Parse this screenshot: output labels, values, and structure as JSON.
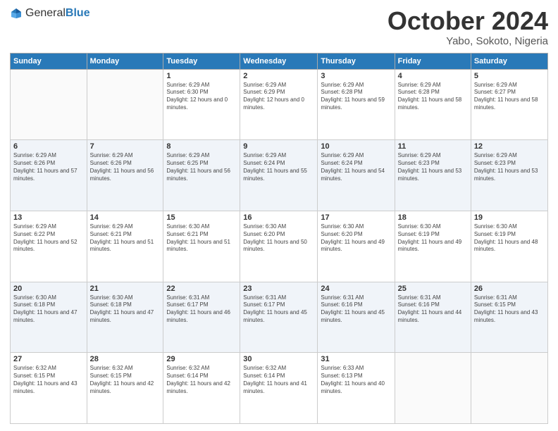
{
  "header": {
    "logo_general": "General",
    "logo_blue": "Blue",
    "month": "October 2024",
    "location": "Yabo, Sokoto, Nigeria"
  },
  "days_of_week": [
    "Sunday",
    "Monday",
    "Tuesday",
    "Wednesday",
    "Thursday",
    "Friday",
    "Saturday"
  ],
  "weeks": [
    [
      {
        "day": "",
        "empty": true
      },
      {
        "day": "",
        "empty": true
      },
      {
        "day": "1",
        "sunrise": "Sunrise: 6:29 AM",
        "sunset": "Sunset: 6:30 PM",
        "daylight": "Daylight: 12 hours and 0 minutes."
      },
      {
        "day": "2",
        "sunrise": "Sunrise: 6:29 AM",
        "sunset": "Sunset: 6:29 PM",
        "daylight": "Daylight: 12 hours and 0 minutes."
      },
      {
        "day": "3",
        "sunrise": "Sunrise: 6:29 AM",
        "sunset": "Sunset: 6:28 PM",
        "daylight": "Daylight: 11 hours and 59 minutes."
      },
      {
        "day": "4",
        "sunrise": "Sunrise: 6:29 AM",
        "sunset": "Sunset: 6:28 PM",
        "daylight": "Daylight: 11 hours and 58 minutes."
      },
      {
        "day": "5",
        "sunrise": "Sunrise: 6:29 AM",
        "sunset": "Sunset: 6:27 PM",
        "daylight": "Daylight: 11 hours and 58 minutes."
      }
    ],
    [
      {
        "day": "6",
        "sunrise": "Sunrise: 6:29 AM",
        "sunset": "Sunset: 6:26 PM",
        "daylight": "Daylight: 11 hours and 57 minutes."
      },
      {
        "day": "7",
        "sunrise": "Sunrise: 6:29 AM",
        "sunset": "Sunset: 6:26 PM",
        "daylight": "Daylight: 11 hours and 56 minutes."
      },
      {
        "day": "8",
        "sunrise": "Sunrise: 6:29 AM",
        "sunset": "Sunset: 6:25 PM",
        "daylight": "Daylight: 11 hours and 56 minutes."
      },
      {
        "day": "9",
        "sunrise": "Sunrise: 6:29 AM",
        "sunset": "Sunset: 6:24 PM",
        "daylight": "Daylight: 11 hours and 55 minutes."
      },
      {
        "day": "10",
        "sunrise": "Sunrise: 6:29 AM",
        "sunset": "Sunset: 6:24 PM",
        "daylight": "Daylight: 11 hours and 54 minutes."
      },
      {
        "day": "11",
        "sunrise": "Sunrise: 6:29 AM",
        "sunset": "Sunset: 6:23 PM",
        "daylight": "Daylight: 11 hours and 53 minutes."
      },
      {
        "day": "12",
        "sunrise": "Sunrise: 6:29 AM",
        "sunset": "Sunset: 6:23 PM",
        "daylight": "Daylight: 11 hours and 53 minutes."
      }
    ],
    [
      {
        "day": "13",
        "sunrise": "Sunrise: 6:29 AM",
        "sunset": "Sunset: 6:22 PM",
        "daylight": "Daylight: 11 hours and 52 minutes."
      },
      {
        "day": "14",
        "sunrise": "Sunrise: 6:29 AM",
        "sunset": "Sunset: 6:21 PM",
        "daylight": "Daylight: 11 hours and 51 minutes."
      },
      {
        "day": "15",
        "sunrise": "Sunrise: 6:30 AM",
        "sunset": "Sunset: 6:21 PM",
        "daylight": "Daylight: 11 hours and 51 minutes."
      },
      {
        "day": "16",
        "sunrise": "Sunrise: 6:30 AM",
        "sunset": "Sunset: 6:20 PM",
        "daylight": "Daylight: 11 hours and 50 minutes."
      },
      {
        "day": "17",
        "sunrise": "Sunrise: 6:30 AM",
        "sunset": "Sunset: 6:20 PM",
        "daylight": "Daylight: 11 hours and 49 minutes."
      },
      {
        "day": "18",
        "sunrise": "Sunrise: 6:30 AM",
        "sunset": "Sunset: 6:19 PM",
        "daylight": "Daylight: 11 hours and 49 minutes."
      },
      {
        "day": "19",
        "sunrise": "Sunrise: 6:30 AM",
        "sunset": "Sunset: 6:19 PM",
        "daylight": "Daylight: 11 hours and 48 minutes."
      }
    ],
    [
      {
        "day": "20",
        "sunrise": "Sunrise: 6:30 AM",
        "sunset": "Sunset: 6:18 PM",
        "daylight": "Daylight: 11 hours and 47 minutes."
      },
      {
        "day": "21",
        "sunrise": "Sunrise: 6:30 AM",
        "sunset": "Sunset: 6:18 PM",
        "daylight": "Daylight: 11 hours and 47 minutes."
      },
      {
        "day": "22",
        "sunrise": "Sunrise: 6:31 AM",
        "sunset": "Sunset: 6:17 PM",
        "daylight": "Daylight: 11 hours and 46 minutes."
      },
      {
        "day": "23",
        "sunrise": "Sunrise: 6:31 AM",
        "sunset": "Sunset: 6:17 PM",
        "daylight": "Daylight: 11 hours and 45 minutes."
      },
      {
        "day": "24",
        "sunrise": "Sunrise: 6:31 AM",
        "sunset": "Sunset: 6:16 PM",
        "daylight": "Daylight: 11 hours and 45 minutes."
      },
      {
        "day": "25",
        "sunrise": "Sunrise: 6:31 AM",
        "sunset": "Sunset: 6:16 PM",
        "daylight": "Daylight: 11 hours and 44 minutes."
      },
      {
        "day": "26",
        "sunrise": "Sunrise: 6:31 AM",
        "sunset": "Sunset: 6:15 PM",
        "daylight": "Daylight: 11 hours and 43 minutes."
      }
    ],
    [
      {
        "day": "27",
        "sunrise": "Sunrise: 6:32 AM",
        "sunset": "Sunset: 6:15 PM",
        "daylight": "Daylight: 11 hours and 43 minutes."
      },
      {
        "day": "28",
        "sunrise": "Sunrise: 6:32 AM",
        "sunset": "Sunset: 6:15 PM",
        "daylight": "Daylight: 11 hours and 42 minutes."
      },
      {
        "day": "29",
        "sunrise": "Sunrise: 6:32 AM",
        "sunset": "Sunset: 6:14 PM",
        "daylight": "Daylight: 11 hours and 42 minutes."
      },
      {
        "day": "30",
        "sunrise": "Sunrise: 6:32 AM",
        "sunset": "Sunset: 6:14 PM",
        "daylight": "Daylight: 11 hours and 41 minutes."
      },
      {
        "day": "31",
        "sunrise": "Sunrise: 6:33 AM",
        "sunset": "Sunset: 6:13 PM",
        "daylight": "Daylight: 11 hours and 40 minutes."
      },
      {
        "day": "",
        "empty": true
      },
      {
        "day": "",
        "empty": true
      }
    ]
  ]
}
